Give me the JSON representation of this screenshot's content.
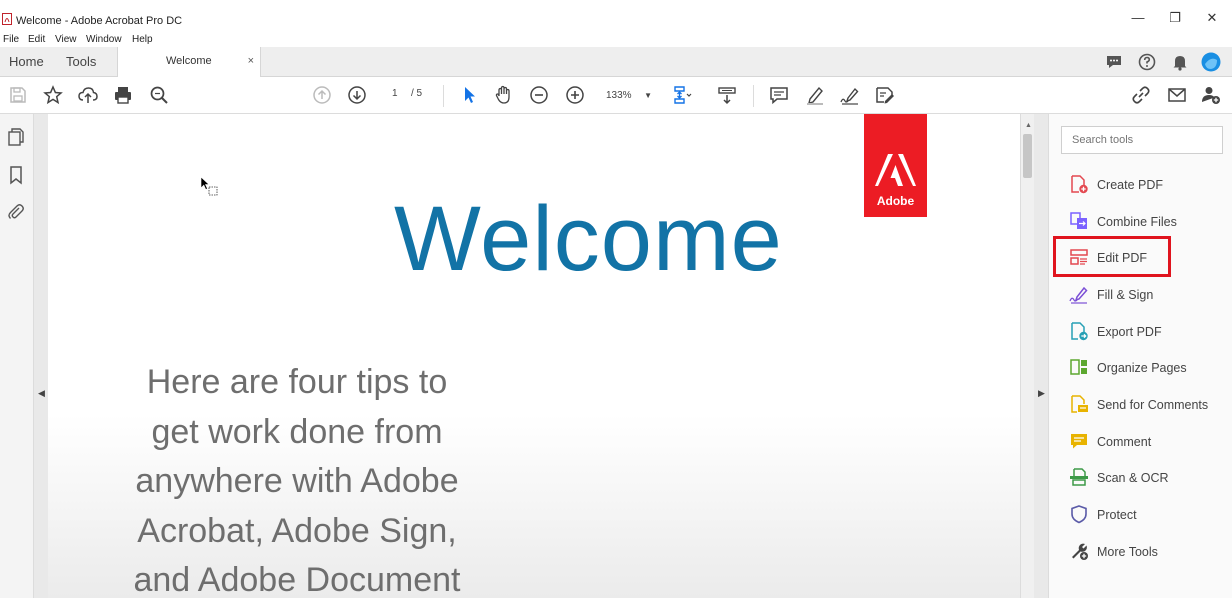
{
  "window": {
    "title": "Welcome - Adobe Acrobat Pro DC",
    "minimize_glyph": "—",
    "restore_glyph": "❐",
    "close_glyph": "✕"
  },
  "menu": [
    "File",
    "Edit",
    "View",
    "Window",
    "Help"
  ],
  "tabs": {
    "home": "Home",
    "tools": "Tools",
    "document": "Welcome",
    "close_glyph": "×"
  },
  "toolbar": {
    "current_page": "1",
    "page_total": "/ 5",
    "zoom": "133%"
  },
  "document": {
    "logo_text": "Adobe",
    "heading": "Welcome",
    "tips_lines": [
      "Here are four tips to",
      "get work done from",
      "anywhere with Adobe",
      "Acrobat, Adobe Sign,",
      "and Adobe Document"
    ]
  },
  "tools_pane": {
    "search_placeholder": "Search tools",
    "items": [
      {
        "label": "Create PDF",
        "icon": "create-pdf-icon",
        "color": "#e34850"
      },
      {
        "label": "Combine Files",
        "icon": "combine-files-icon",
        "color": "#7b61ff"
      },
      {
        "label": "Edit PDF",
        "icon": "edit-pdf-icon",
        "color": "#e34850",
        "highlighted": true
      },
      {
        "label": "Fill & Sign",
        "icon": "fill-sign-icon",
        "color": "#7b4fd6"
      },
      {
        "label": "Export PDF",
        "icon": "export-pdf-icon",
        "color": "#26a0b5"
      },
      {
        "label": "Organize Pages",
        "icon": "organize-pages-icon",
        "color": "#5ca72f"
      },
      {
        "label": "Send for Comments",
        "icon": "send-comments-icon",
        "color": "#e8b300"
      },
      {
        "label": "Comment",
        "icon": "comment-icon",
        "color": "#e8b300"
      },
      {
        "label": "Scan & OCR",
        "icon": "scan-ocr-icon",
        "color": "#3d9a48"
      },
      {
        "label": "Protect",
        "icon": "protect-icon",
        "color": "#5b5ba8"
      },
      {
        "label": "More Tools",
        "icon": "more-tools-icon",
        "color": "#444444"
      }
    ]
  },
  "colors": {
    "accent": "#1273a6",
    "adobe_red": "#ec1c24",
    "highlight": "#e0141e"
  }
}
